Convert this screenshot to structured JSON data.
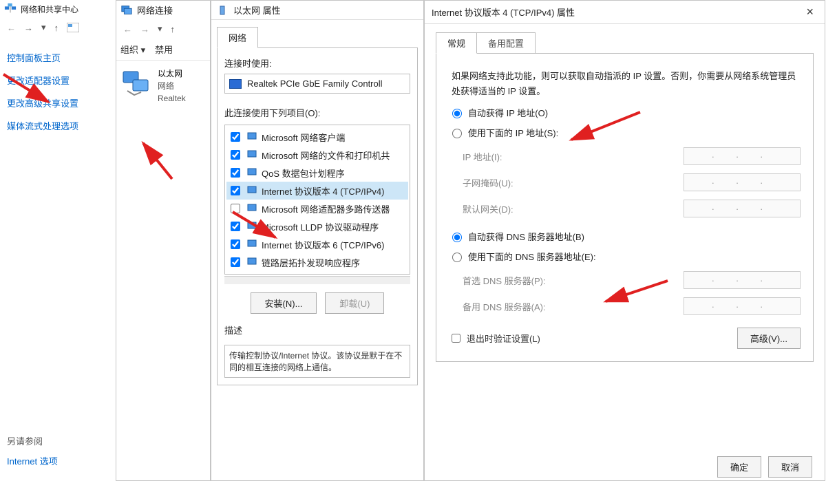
{
  "p1": {
    "title": "网络和共享中心",
    "nav_back": "←",
    "nav_fwd": "→",
    "nav_up": "↑",
    "link_home": "控制面板主页",
    "link_adapter": "更改适配器设置",
    "link_advanced": "更改高级共享设置",
    "link_media": "媒体流式处理选项",
    "see_also": "另请参阅",
    "internet_options": "Internet 选项"
  },
  "p2": {
    "title": "网络连接",
    "organize": "组织 ▾",
    "disable": "禁用",
    "adapter_name": "以太网",
    "adapter_net": "网络",
    "adapter_device": "Realtek"
  },
  "p3": {
    "title": "以太网 属性",
    "tab_network": "网络",
    "connect_using": "连接时使用:",
    "device": "Realtek PCIe GbE Family Controll",
    "items_label": "此连接使用下列项目(O):",
    "items": [
      {
        "checked": true,
        "label": "Microsoft 网络客户端",
        "sel": false
      },
      {
        "checked": true,
        "label": "Microsoft 网络的文件和打印机共",
        "sel": false
      },
      {
        "checked": true,
        "label": "QoS 数据包计划程序",
        "sel": false
      },
      {
        "checked": true,
        "label": "Internet 协议版本 4 (TCP/IPv4)",
        "sel": true
      },
      {
        "checked": false,
        "label": "Microsoft 网络适配器多路传送器",
        "sel": false
      },
      {
        "checked": true,
        "label": "Microsoft LLDP 协议驱动程序",
        "sel": false
      },
      {
        "checked": true,
        "label": "Internet 协议版本 6 (TCP/IPv6)",
        "sel": false
      },
      {
        "checked": true,
        "label": "链路层拓扑发现响应程序",
        "sel": false
      }
    ],
    "install": "安装(N)...",
    "uninstall": "卸载(U)",
    "desc_title": "描述",
    "desc_text": "传输控制协议/Internet 协议。该协议是默于在不同的相互连接的网络上通信。"
  },
  "p4": {
    "title": "Internet 协议版本 4 (TCP/IPv4) 属性",
    "tab_general": "常规",
    "tab_alt": "备用配置",
    "intro": "如果网络支持此功能，则可以获取自动指派的 IP 设置。否则，你需要从网络系统管理员处获得适当的 IP 设置。",
    "radio_auto_ip": "自动获得 IP 地址(O)",
    "radio_use_ip": "使用下面的 IP 地址(S):",
    "label_ip": "IP 地址(I):",
    "label_mask": "子网掩码(U):",
    "label_gw": "默认网关(D):",
    "radio_auto_dns": "自动获得 DNS 服务器地址(B)",
    "radio_use_dns": "使用下面的 DNS 服务器地址(E):",
    "label_dns1": "首选 DNS 服务器(P):",
    "label_dns2": "备用 DNS 服务器(A):",
    "validate": "退出时验证设置(L)",
    "advanced": "高级(V)...",
    "ok": "确定",
    "cancel": "取消",
    "dots": ".  .  ."
  }
}
